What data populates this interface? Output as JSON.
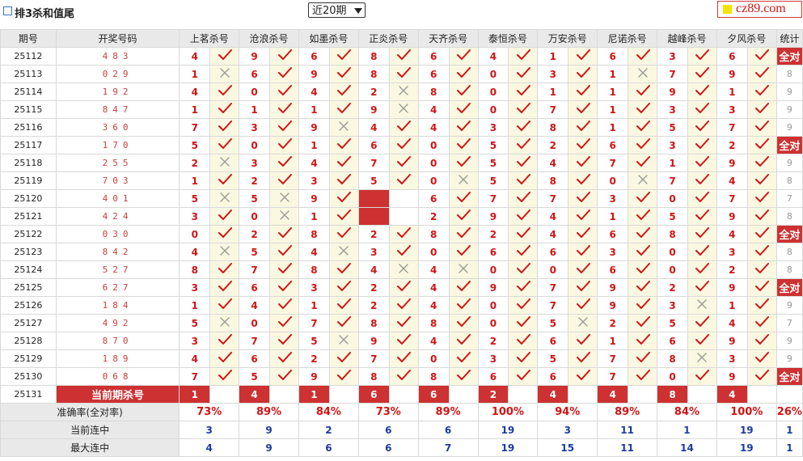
{
  "header": {
    "title": "排3杀和值尾",
    "period_select": "近20期",
    "logo": "cz89.com"
  },
  "columns": {
    "period": "期号",
    "winning": "开奖号码",
    "stat": "统计",
    "experts": [
      "上茗杀号",
      "沧浪杀号",
      "如墨杀号",
      "正炎杀号",
      "天齐杀号",
      "泰恒杀号",
      "万安杀号",
      "尼诺杀号",
      "越峰杀号",
      "夕风杀号"
    ]
  },
  "rows": [
    {
      "period": "25112",
      "number": "483",
      "picks": [
        [
          "4",
          1
        ],
        [
          "9",
          1
        ],
        [
          "6",
          1
        ],
        [
          "8",
          1
        ],
        [
          "6",
          1
        ],
        [
          "4",
          1
        ],
        [
          "1",
          1
        ],
        [
          "6",
          1
        ],
        [
          "3",
          1
        ],
        [
          "6",
          1
        ]
      ],
      "stat": "全对"
    },
    {
      "period": "25113",
      "number": "029",
      "picks": [
        [
          "1",
          0
        ],
        [
          "6",
          1
        ],
        [
          "9",
          1
        ],
        [
          "8",
          1
        ],
        [
          "6",
          1
        ],
        [
          "0",
          1
        ],
        [
          "3",
          1
        ],
        [
          "1",
          0
        ],
        [
          "7",
          1
        ],
        [
          "9",
          1
        ]
      ],
      "stat": "8"
    },
    {
      "period": "25114",
      "number": "192",
      "picks": [
        [
          "4",
          1
        ],
        [
          "0",
          1
        ],
        [
          "4",
          1
        ],
        [
          "2",
          0
        ],
        [
          "8",
          1
        ],
        [
          "0",
          1
        ],
        [
          "1",
          1
        ],
        [
          "1",
          1
        ],
        [
          "9",
          1
        ],
        [
          "1",
          1
        ]
      ],
      "stat": "9"
    },
    {
      "period": "25115",
      "number": "847",
      "picks": [
        [
          "1",
          1
        ],
        [
          "1",
          1
        ],
        [
          "1",
          1
        ],
        [
          "9",
          0
        ],
        [
          "4",
          1
        ],
        [
          "0",
          1
        ],
        [
          "7",
          1
        ],
        [
          "1",
          1
        ],
        [
          "3",
          1
        ],
        [
          "3",
          1
        ]
      ],
      "stat": "9"
    },
    {
      "period": "25116",
      "number": "360",
      "picks": [
        [
          "7",
          1
        ],
        [
          "3",
          1
        ],
        [
          "9",
          0
        ],
        [
          "4",
          1
        ],
        [
          "4",
          1
        ],
        [
          "3",
          1
        ],
        [
          "8",
          1
        ],
        [
          "1",
          1
        ],
        [
          "5",
          1
        ],
        [
          "7",
          1
        ]
      ],
      "stat": "9"
    },
    {
      "period": "25117",
      "number": "170",
      "picks": [
        [
          "5",
          1
        ],
        [
          "0",
          1
        ],
        [
          "1",
          1
        ],
        [
          "6",
          1
        ],
        [
          "0",
          1
        ],
        [
          "5",
          1
        ],
        [
          "2",
          1
        ],
        [
          "6",
          1
        ],
        [
          "3",
          1
        ],
        [
          "2",
          1
        ]
      ],
      "stat": "全对"
    },
    {
      "period": "25118",
      "number": "255",
      "picks": [
        [
          "2",
          0
        ],
        [
          "3",
          1
        ],
        [
          "4",
          1
        ],
        [
          "7",
          1
        ],
        [
          "0",
          1
        ],
        [
          "5",
          1
        ],
        [
          "4",
          1
        ],
        [
          "7",
          1
        ],
        [
          "1",
          1
        ],
        [
          "9",
          1
        ]
      ],
      "stat": "9"
    },
    {
      "period": "25119",
      "number": "703",
      "picks": [
        [
          "1",
          1
        ],
        [
          "2",
          1
        ],
        [
          "3",
          1
        ],
        [
          "5",
          1
        ],
        [
          "0",
          0
        ],
        [
          "5",
          1
        ],
        [
          "8",
          1
        ],
        [
          "0",
          0
        ],
        [
          "7",
          1
        ],
        [
          "4",
          1
        ]
      ],
      "stat": "8"
    },
    {
      "period": "25120",
      "number": "401",
      "picks": [
        [
          "5",
          0
        ],
        [
          "5",
          0
        ],
        [
          "9",
          1
        ],
        [
          "",
          2
        ],
        [
          "6",
          1
        ],
        [
          "7",
          1
        ],
        [
          "7",
          1
        ],
        [
          "3",
          1
        ],
        [
          "0",
          1
        ],
        [
          "7",
          1
        ]
      ],
      "stat": "7"
    },
    {
      "period": "25121",
      "number": "424",
      "picks": [
        [
          "3",
          1
        ],
        [
          "0",
          0
        ],
        [
          "1",
          1
        ],
        [
          "",
          2
        ],
        [
          "2",
          1
        ],
        [
          "9",
          1
        ],
        [
          "4",
          1
        ],
        [
          "1",
          1
        ],
        [
          "5",
          1
        ],
        [
          "9",
          1
        ]
      ],
      "stat": "8"
    },
    {
      "period": "25122",
      "number": "030",
      "picks": [
        [
          "0",
          1
        ],
        [
          "2",
          1
        ],
        [
          "8",
          1
        ],
        [
          "2",
          1
        ],
        [
          "8",
          1
        ],
        [
          "2",
          1
        ],
        [
          "4",
          1
        ],
        [
          "6",
          1
        ],
        [
          "8",
          1
        ],
        [
          "4",
          1
        ]
      ],
      "stat": "全对"
    },
    {
      "period": "25123",
      "number": "842",
      "picks": [
        [
          "4",
          0
        ],
        [
          "5",
          1
        ],
        [
          "4",
          0
        ],
        [
          "3",
          1
        ],
        [
          "0",
          1
        ],
        [
          "6",
          1
        ],
        [
          "6",
          1
        ],
        [
          "3",
          1
        ],
        [
          "0",
          1
        ],
        [
          "3",
          1
        ]
      ],
      "stat": "8"
    },
    {
      "period": "25124",
      "number": "527",
      "picks": [
        [
          "8",
          1
        ],
        [
          "7",
          1
        ],
        [
          "8",
          1
        ],
        [
          "4",
          0
        ],
        [
          "4",
          0
        ],
        [
          "0",
          1
        ],
        [
          "0",
          1
        ],
        [
          "6",
          1
        ],
        [
          "0",
          1
        ],
        [
          "2",
          1
        ]
      ],
      "stat": "8"
    },
    {
      "period": "25125",
      "number": "627",
      "picks": [
        [
          "3",
          1
        ],
        [
          "6",
          1
        ],
        [
          "3",
          1
        ],
        [
          "2",
          1
        ],
        [
          "4",
          1
        ],
        [
          "9",
          1
        ],
        [
          "7",
          1
        ],
        [
          "9",
          1
        ],
        [
          "2",
          1
        ],
        [
          "9",
          1
        ]
      ],
      "stat": "全对"
    },
    {
      "period": "25126",
      "number": "184",
      "picks": [
        [
          "1",
          1
        ],
        [
          "4",
          1
        ],
        [
          "1",
          1
        ],
        [
          "2",
          1
        ],
        [
          "4",
          1
        ],
        [
          "0",
          1
        ],
        [
          "7",
          1
        ],
        [
          "9",
          1
        ],
        [
          "3",
          0
        ],
        [
          "1",
          1
        ]
      ],
      "stat": "9"
    },
    {
      "period": "25127",
      "number": "492",
      "picks": [
        [
          "5",
          0
        ],
        [
          "0",
          1
        ],
        [
          "7",
          1
        ],
        [
          "8",
          1
        ],
        [
          "8",
          1
        ],
        [
          "0",
          1
        ],
        [
          "5",
          0
        ],
        [
          "2",
          1
        ],
        [
          "5",
          1
        ],
        [
          "4",
          1
        ]
      ],
      "stat": "7"
    },
    {
      "period": "25128",
      "number": "870",
      "picks": [
        [
          "3",
          1
        ],
        [
          "7",
          1
        ],
        [
          "5",
          0
        ],
        [
          "9",
          1
        ],
        [
          "4",
          1
        ],
        [
          "2",
          1
        ],
        [
          "6",
          1
        ],
        [
          "1",
          1
        ],
        [
          "6",
          1
        ],
        [
          "9",
          1
        ]
      ],
      "stat": "9"
    },
    {
      "period": "25129",
      "number": "189",
      "picks": [
        [
          "4",
          1
        ],
        [
          "6",
          1
        ],
        [
          "2",
          1
        ],
        [
          "7",
          1
        ],
        [
          "0",
          1
        ],
        [
          "3",
          1
        ],
        [
          "5",
          1
        ],
        [
          "7",
          1
        ],
        [
          "8",
          0
        ],
        [
          "3",
          1
        ]
      ],
      "stat": "9"
    },
    {
      "period": "25130",
      "number": "068",
      "picks": [
        [
          "7",
          1
        ],
        [
          "5",
          1
        ],
        [
          "9",
          1
        ],
        [
          "8",
          1
        ],
        [
          "8",
          1
        ],
        [
          "6",
          1
        ],
        [
          "6",
          1
        ],
        [
          "7",
          1
        ],
        [
          "0",
          1
        ],
        [
          "9",
          1
        ]
      ],
      "stat": "全对"
    }
  ],
  "current": {
    "period": "25131",
    "label": "当前期杀号",
    "picks": [
      "1",
      "4",
      "1",
      "6",
      "6",
      "2",
      "4",
      "4",
      "8",
      "4"
    ]
  },
  "summary": {
    "accuracy_label": "准确率(全对率)",
    "accuracy": [
      "73%",
      "89%",
      "84%",
      "73%",
      "89%",
      "100%",
      "94%",
      "89%",
      "84%",
      "100%"
    ],
    "accuracy_stat": "26%",
    "streak_label": "当前连中",
    "streak": [
      "3",
      "9",
      "2",
      "6",
      "6",
      "19",
      "3",
      "11",
      "1",
      "19"
    ],
    "streak_stat": "1",
    "max_label": "最大连中",
    "max": [
      "4",
      "9",
      "6",
      "6",
      "7",
      "19",
      "15",
      "11",
      "14",
      "19"
    ],
    "max_stat": "1"
  },
  "colors": {
    "accent_red": "#cd3131",
    "check_red": "#d01414",
    "cross_gray": "#9a9a9a",
    "pale_cell": "#fbf8e1",
    "header_gray": "#e9e9e9",
    "count_blue": "#1c3ba0"
  }
}
